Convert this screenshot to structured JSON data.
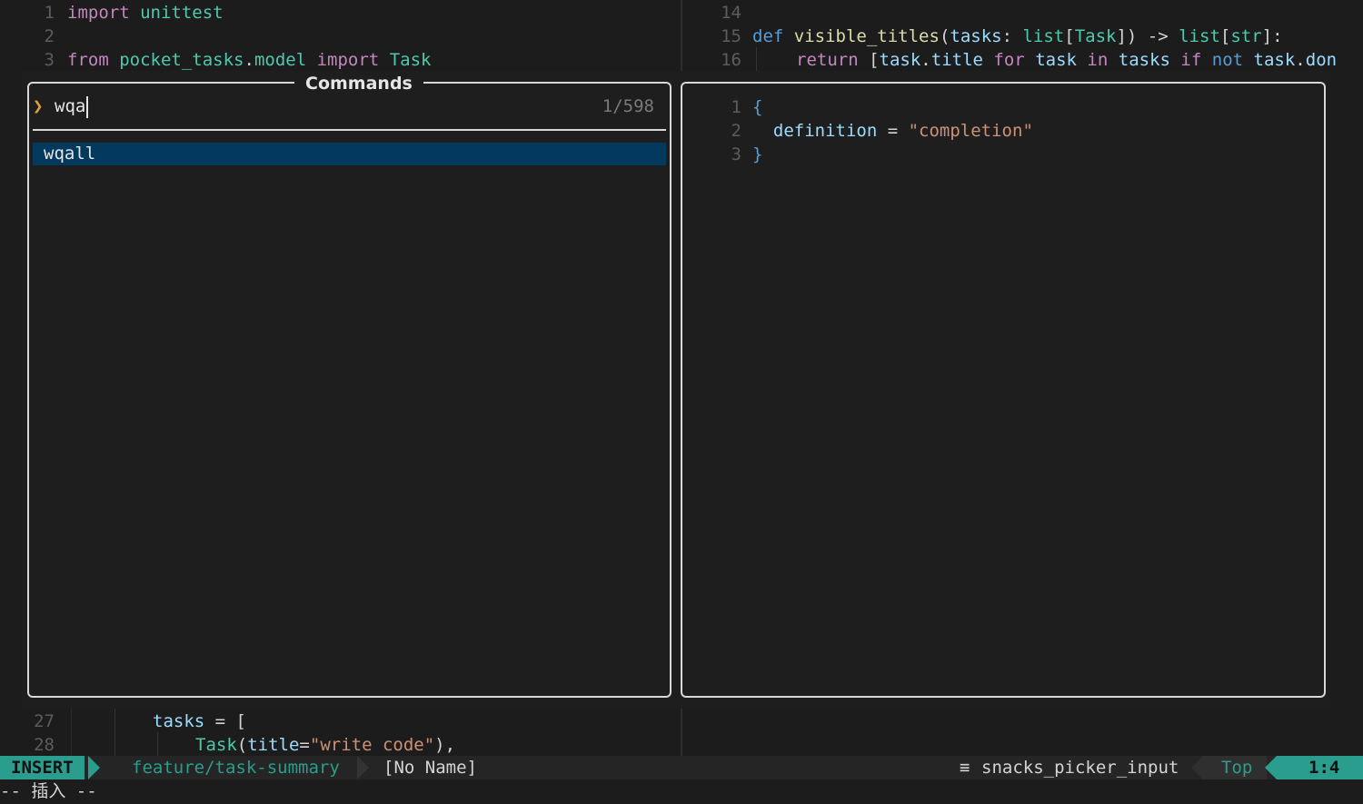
{
  "editor_left": {
    "lines": [
      {
        "num": "1",
        "tokens": [
          {
            "t": "import",
            "c": "kw"
          },
          {
            "t": " "
          },
          {
            "t": "unittest",
            "c": "mod"
          }
        ]
      },
      {
        "num": "2",
        "tokens": []
      },
      {
        "num": "3",
        "tokens": [
          {
            "t": "from",
            "c": "kw"
          },
          {
            "t": " "
          },
          {
            "t": "pocket_tasks",
            "c": "mod"
          },
          {
            "t": ".",
            "c": "op"
          },
          {
            "t": "model",
            "c": "mod"
          },
          {
            "t": " "
          },
          {
            "t": "import",
            "c": "kw"
          },
          {
            "t": " "
          },
          {
            "t": "Task",
            "c": "mod"
          }
        ]
      }
    ],
    "bottom_lines": [
      {
        "num": "27",
        "tokens": [
          {
            "t": "tasks",
            "c": "var"
          },
          {
            "t": " = [",
            "c": "op"
          }
        ]
      },
      {
        "num": "28",
        "tokens": [
          {
            "t": "Task",
            "c": "mod"
          },
          {
            "t": "(",
            "c": "op"
          },
          {
            "t": "title",
            "c": "var"
          },
          {
            "t": "=",
            "c": "op"
          },
          {
            "t": "\"write code\"",
            "c": "str"
          },
          {
            "t": "),",
            "c": "op"
          }
        ]
      }
    ]
  },
  "editor_right": {
    "lines": [
      {
        "num": "14",
        "tokens": []
      },
      {
        "num": "15",
        "tokens": [
          {
            "t": "def",
            "c": "kwb"
          },
          {
            "t": " "
          },
          {
            "t": "visible_titles",
            "c": "fn"
          },
          {
            "t": "(",
            "c": "op"
          },
          {
            "t": "tasks",
            "c": "var"
          },
          {
            "t": ": ",
            "c": "op"
          },
          {
            "t": "list",
            "c": "mod"
          },
          {
            "t": "[",
            "c": "op"
          },
          {
            "t": "Task",
            "c": "mod"
          },
          {
            "t": "]) -> ",
            "c": "op"
          },
          {
            "t": "list",
            "c": "mod"
          },
          {
            "t": "[",
            "c": "op"
          },
          {
            "t": "str",
            "c": "mod"
          },
          {
            "t": "]:",
            "c": "op"
          }
        ]
      },
      {
        "num": "16",
        "tokens": [
          {
            "t": "return",
            "c": "kw"
          },
          {
            "t": " [",
            "c": "op"
          },
          {
            "t": "task",
            "c": "var"
          },
          {
            "t": ".",
            "c": "op"
          },
          {
            "t": "title",
            "c": "var"
          },
          {
            "t": " "
          },
          {
            "t": "for",
            "c": "kw"
          },
          {
            "t": " "
          },
          {
            "t": "task",
            "c": "var"
          },
          {
            "t": " "
          },
          {
            "t": "in",
            "c": "kw"
          },
          {
            "t": " "
          },
          {
            "t": "tasks",
            "c": "var"
          },
          {
            "t": " "
          },
          {
            "t": "if",
            "c": "kw"
          },
          {
            "t": " "
          },
          {
            "t": "not",
            "c": "kwb"
          },
          {
            "t": " "
          },
          {
            "t": "task",
            "c": "var"
          },
          {
            "t": ".",
            "c": "op"
          },
          {
            "t": "don",
            "c": "var"
          }
        ]
      }
    ]
  },
  "picker": {
    "title": "Commands",
    "prompt_symbol": "❯",
    "query": "wqa",
    "count": "1/598",
    "results": [
      "wqall"
    ]
  },
  "preview": {
    "lines": [
      {
        "num": "1",
        "tokens": [
          {
            "t": "{",
            "c": "kwb"
          }
        ]
      },
      {
        "num": "2",
        "tokens": [
          {
            "t": "  "
          },
          {
            "t": "definition",
            "c": "var"
          },
          {
            "t": " = ",
            "c": "op"
          },
          {
            "t": "\"completion\"",
            "c": "str"
          }
        ]
      },
      {
        "num": "3",
        "tokens": [
          {
            "t": "}",
            "c": "kwb"
          }
        ]
      }
    ]
  },
  "statusbar": {
    "mode": "INSERT",
    "branch_icon": "",
    "branch": "feature/task-summary",
    "filename": "[No Name]",
    "os_icon": "",
    "separator": "",
    "filetype_icon": "≡",
    "filetype": "snacks_picker_input",
    "position": "Top",
    "location": "1:4"
  },
  "cmdline": "-- 插入 --",
  "colors": {
    "accent": "#2a9d8f",
    "selection": "#04395e",
    "border": "#d8d8d8",
    "background": "#1e1e1e"
  }
}
